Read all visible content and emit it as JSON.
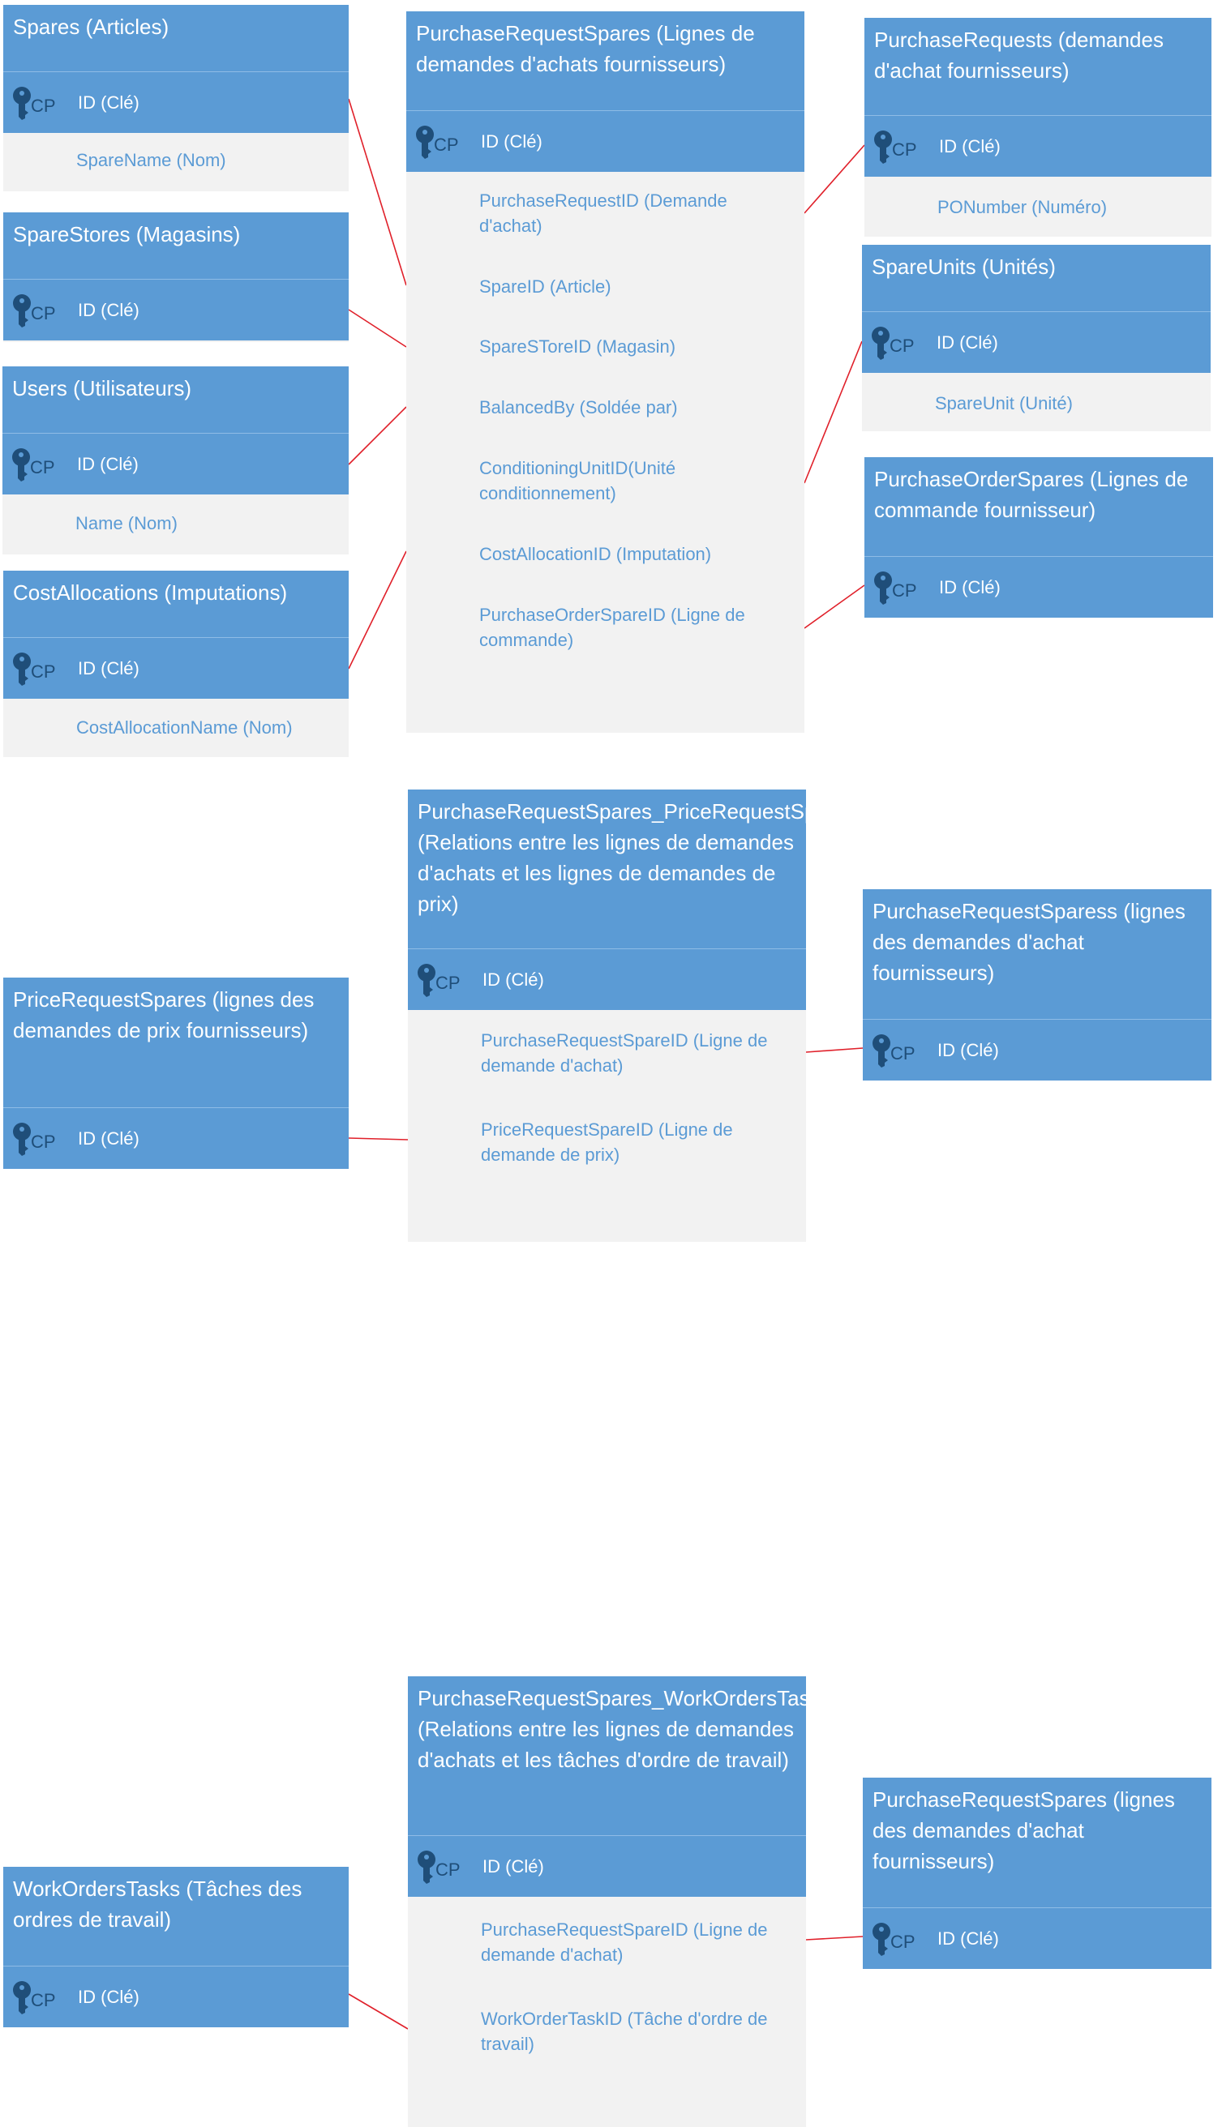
{
  "pk_tag": "CP",
  "colors": {
    "header": "#5b9bd5",
    "body": "#f2f2f2",
    "field_text": "#5b9bd5",
    "key_icon": "#1f4e79",
    "connector": "#e0202a"
  },
  "icons": {
    "primary_key": "key-icon"
  },
  "entities": [
    {
      "title": "Spares (Articles)",
      "pk": "ID (Clé)",
      "fields": [
        "SpareName (Nom)"
      ]
    },
    {
      "title": "SpareStores (Magasins)",
      "pk": "ID (Clé)",
      "fields": []
    },
    {
      "title": "Users (Utilisateurs)",
      "pk": "ID (Clé)",
      "fields": [
        "Name (Nom)"
      ]
    },
    {
      "title": "CostAllocations (Imputations)",
      "pk": "ID (Clé)",
      "fields": [
        "CostAllocationName (Nom)"
      ]
    },
    {
      "title": "PurchaseRequestSpares (Lignes de demandes d'achats fournisseurs)",
      "pk": "ID (Clé)",
      "fields": [
        "PurchaseRequestID (Demande d'achat)",
        "SpareID (Article)",
        "SpareSToreID (Magasin)",
        "BalancedBy (Soldée par)",
        "ConditioningUnitID(Unité conditionnement)",
        "CostAllocationID (Imputation)",
        "PurchaseOrderSpareID (Ligne de commande)"
      ]
    },
    {
      "title": "PurchaseRequests (demandes d'achat fournisseurs)",
      "pk": "ID (Clé)",
      "fields": [
        "PONumber (Numéro)"
      ]
    },
    {
      "title": "SpareUnits (Unités)",
      "pk": "ID (Clé)",
      "fields": [
        "SpareUnit (Unité)"
      ]
    },
    {
      "title": "PurchaseOrderSpares (Lignes de commande fournisseur)",
      "pk": "ID (Clé)",
      "fields": []
    },
    {
      "title": "PurchaseRequestSpares_PriceRequestSpares (Relations entre les lignes de demandes d'achats et les lignes de demandes de prix)",
      "pk": "ID (Clé)",
      "fields": [
        "PurchaseRequestSpareID (Ligne de demande d'achat)",
        "PriceRequestSpareID (Ligne de demande de prix)"
      ]
    },
    {
      "title": "PriceRequestSpares (lignes des demandes de prix fournisseurs)",
      "pk": "ID (Clé)",
      "fields": []
    },
    {
      "title": "PurchaseRequestSparess (lignes des demandes d'achat fournisseurs)",
      "pk": "ID (Clé)",
      "fields": []
    },
    {
      "title": "PurchaseRequestSpares_WorkOrdersTasks (Relations entre les lignes de demandes d'achats et les tâches d'ordre de travail)",
      "pk": "ID (Clé)",
      "fields": [
        "PurchaseRequestSpareID (Ligne de demande d'achat)",
        "WorkOrderTaskID (Tâche d'ordre de travail)"
      ]
    },
    {
      "title": "WorkOrdersTasks (Tâches des ordres de travail)",
      "pk": "ID (Clé)",
      "fields": []
    },
    {
      "title": "PurchaseRequestSpares (lignes des demandes d'achat fournisseurs)",
      "pk": "ID (Clé)",
      "fields": []
    }
  ]
}
